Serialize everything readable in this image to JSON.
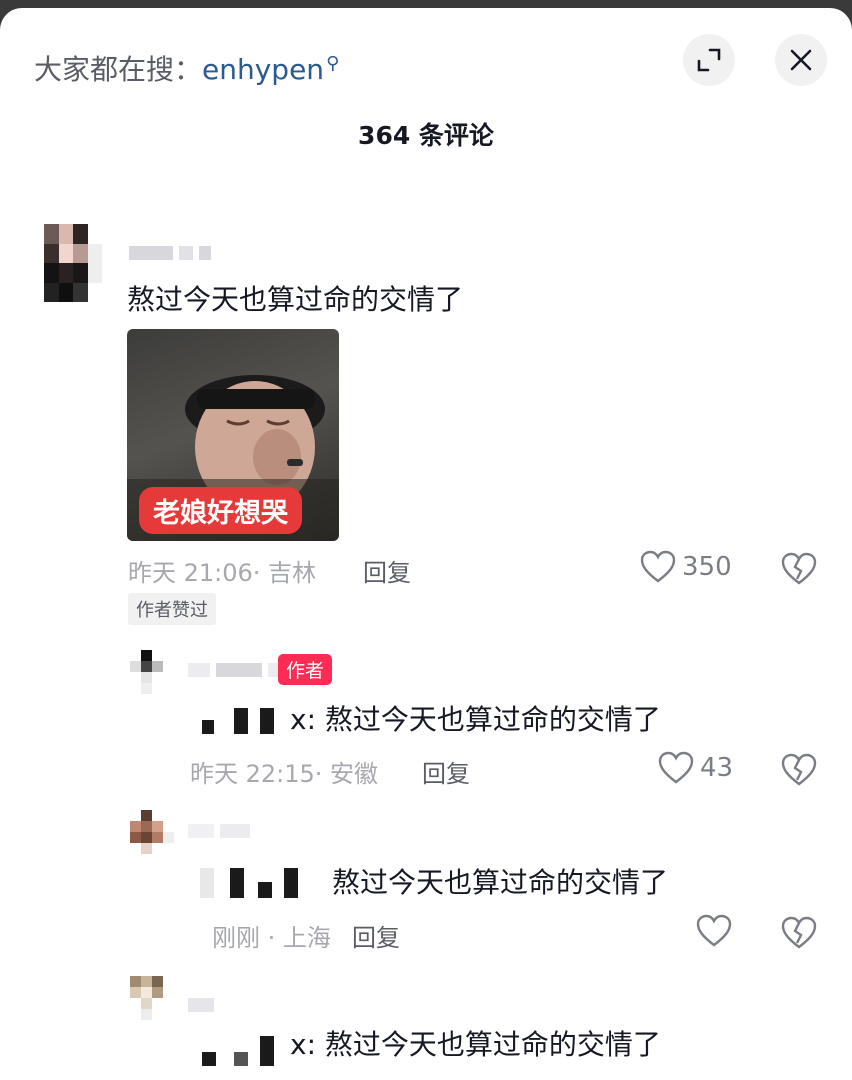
{
  "header": {
    "search_prefix": "大家都在搜：",
    "search_keyword": "enhypen",
    "search_mark": "⚲",
    "comment_count": "364 条评论"
  },
  "comments": [
    {
      "text": "熬过今天也算过命的交情了",
      "sticker_caption": "老娘好想哭",
      "meta": "昨天 21:06· 吉林",
      "reply": "回复",
      "likes": "350",
      "badge": "作者赞过"
    },
    {
      "author_badge": "作者",
      "text": "x: 熬过今天也算过命的交情了",
      "meta": "昨天 22:15· 安徽",
      "reply": "回复",
      "likes": "43"
    },
    {
      "text": "熬过今天也算过命的交情了",
      "meta": "刚刚 · 上海",
      "reply": "回复",
      "likes": ""
    },
    {
      "text": "x: 熬过今天也算过命的交情了"
    }
  ],
  "colors": {
    "accent_red": "#fe2c55",
    "keyword_blue": "#2a5a92",
    "sticker_red": "#e6393a"
  },
  "icons": [
    "search-icon",
    "expand-icon",
    "close-icon",
    "heart-icon",
    "broken-heart-icon"
  ]
}
